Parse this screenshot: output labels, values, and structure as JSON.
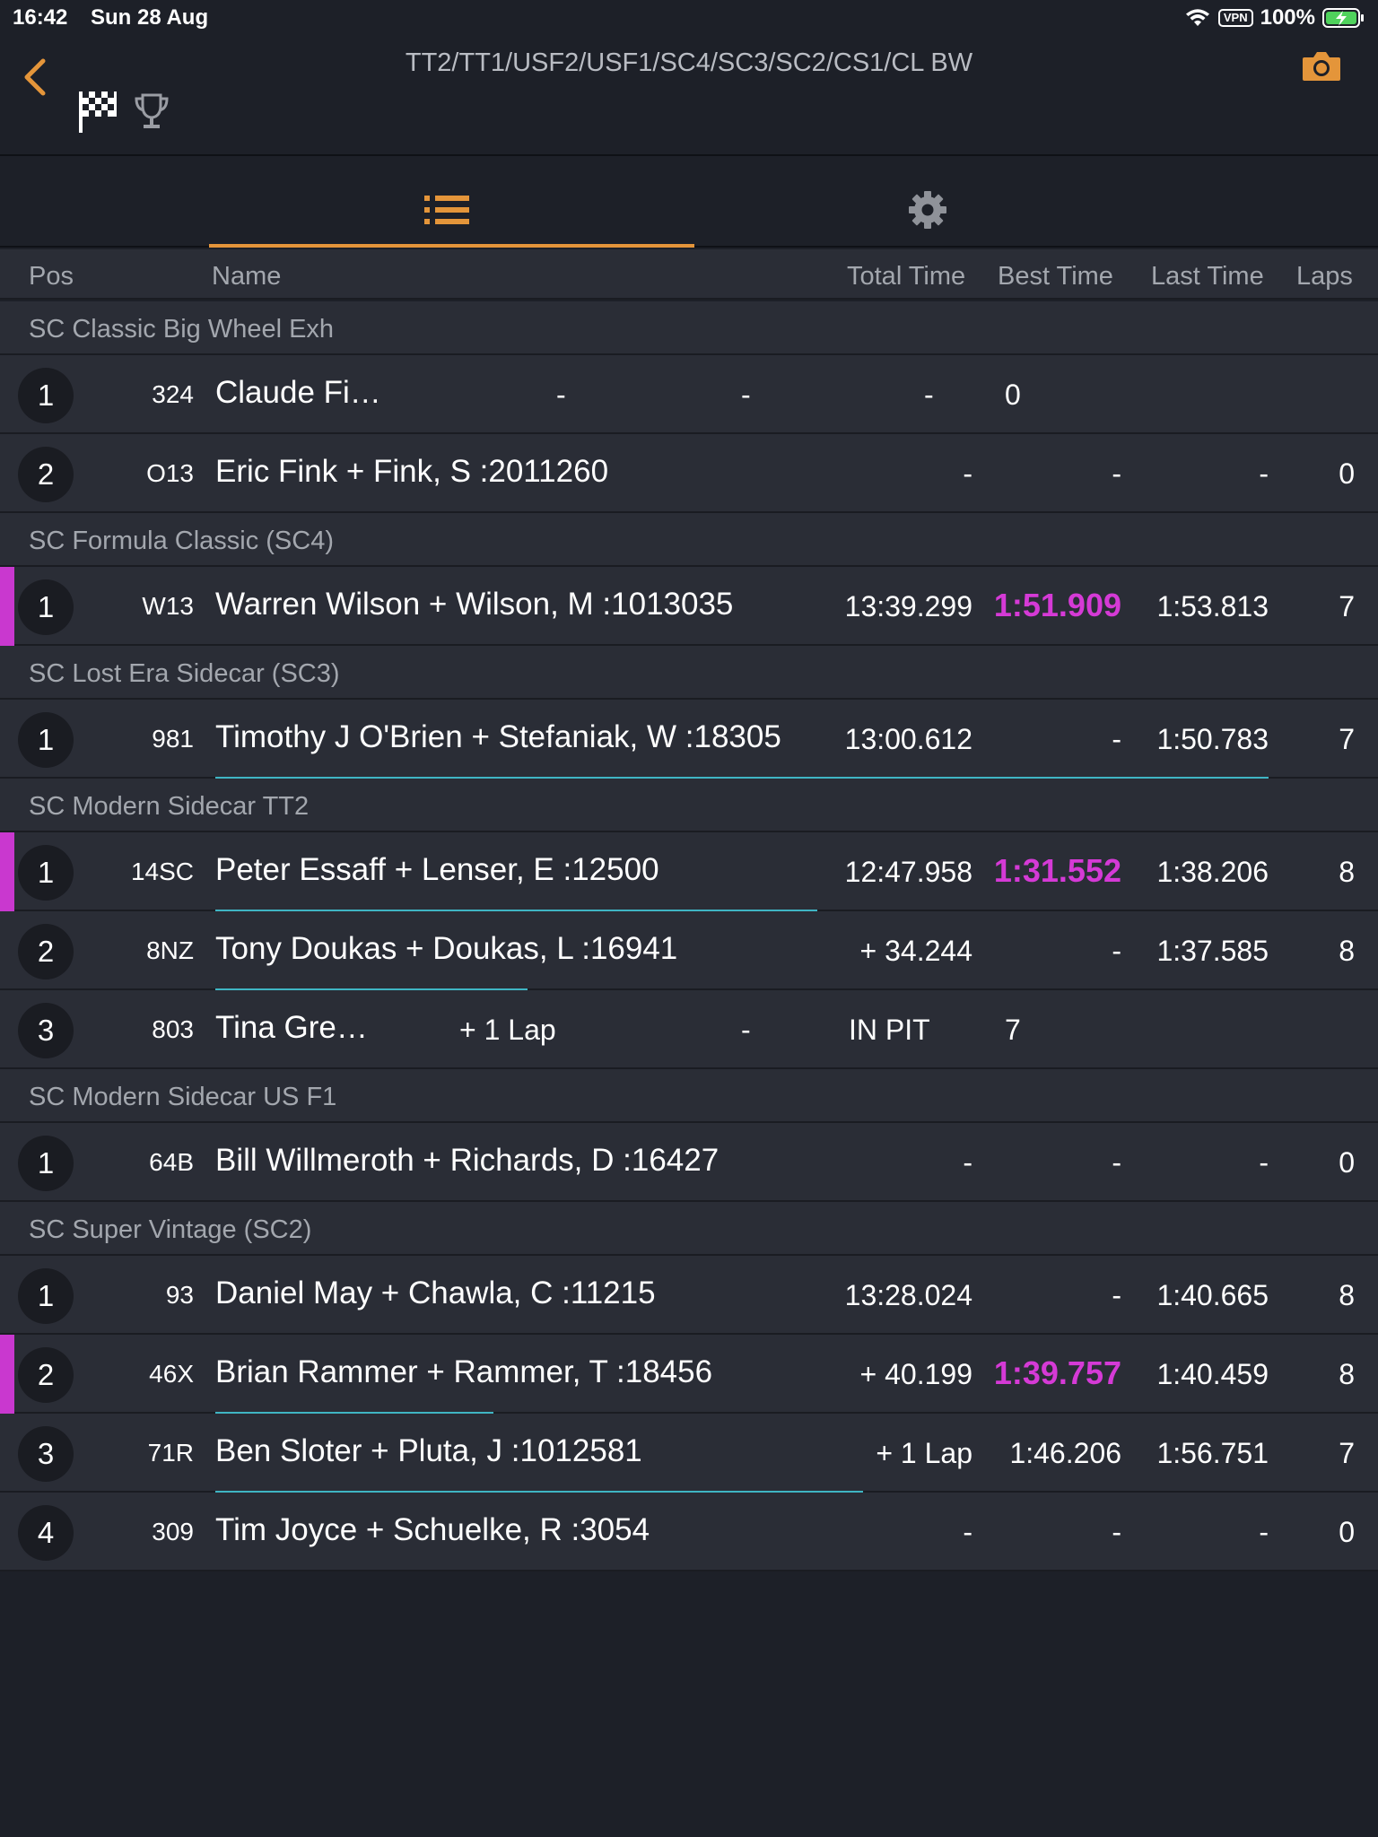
{
  "status_bar": {
    "time": "16:42",
    "date": "Sun 28 Aug",
    "vpn": "VPN",
    "battery": "100%"
  },
  "header": {
    "title": "TT2/TT1/USF2/USF1/SC4/SC3/SC2/CS1/CL BW",
    "icons": [
      "back-chevron-icon",
      "camera-icon",
      "checkered-flag-icon",
      "trophy-icon"
    ]
  },
  "tabs": [
    {
      "icon": "list-icon",
      "active": true
    },
    {
      "icon": "gear-icon",
      "active": false
    }
  ],
  "columns": {
    "pos": "Pos",
    "name": "Name",
    "total": "Total Time",
    "best": "Best Time",
    "last": "Last Time",
    "laps": "Laps"
  },
  "colors": {
    "accent": "#e4953a",
    "fastest": "#d53ad6",
    "progress": "#3fb5c4",
    "row_bg": "#2a2d36",
    "page_bg": "#1d2028"
  },
  "groups": [
    {
      "title": "SC Classic Big Wheel Exh",
      "rows": [
        {
          "pos": "1",
          "num": "324",
          "name": "Claude Fi…",
          "cells": [
            "-",
            "-",
            "-",
            "0"
          ],
          "layout": "truncated"
        },
        {
          "pos": "2",
          "num": "O13",
          "name": "Eric Fink + Fink, S :2011260",
          "total": "-",
          "best": "-",
          "last": "-",
          "laps": "0"
        }
      ]
    },
    {
      "title": "SC Formula Classic (SC4)",
      "rows": [
        {
          "pos": "1",
          "num": "W13",
          "name": "Warren Wilson + Wilson, M :1013035",
          "total": "13:39.299",
          "best": "1:51.909",
          "best_fastest": true,
          "last": "1:53.813",
          "laps": "7",
          "leader": true
        }
      ]
    },
    {
      "title": "SC Lost Era Sidecar (SC3)",
      "rows": [
        {
          "pos": "1",
          "num": "981",
          "name": "Timothy J O'Brien + Stefaniak, W :18305",
          "total": "13:00.612",
          "best": "-",
          "last": "1:50.783",
          "laps": "7",
          "progress": 0.91
        }
      ]
    },
    {
      "title": "SC Modern Sidecar TT2",
      "rows": [
        {
          "pos": "1",
          "num": "14SC",
          "name": "Peter Essaff + Lenser, E :12500",
          "total": "12:47.958",
          "best": "1:31.552",
          "best_fastest": true,
          "last": "1:38.206",
          "laps": "8",
          "leader": true,
          "progress": 0.52
        },
        {
          "pos": "2",
          "num": "8NZ",
          "name": "Tony Doukas + Doukas, L :16941",
          "total": "+ 34.244",
          "best": "-",
          "last": "1:37.585",
          "laps": "8",
          "progress": 0.27
        },
        {
          "pos": "3",
          "num": "803",
          "name": "Tina Gre…",
          "cells": [
            "+ 1 Lap",
            "-",
            "IN PIT",
            "7"
          ],
          "layout": "pit"
        }
      ]
    },
    {
      "title": "SC Modern Sidecar US F1",
      "rows": [
        {
          "pos": "1",
          "num": "64B",
          "name": "Bill Willmeroth + Richards, D :16427",
          "total": "-",
          "best": "-",
          "last": "-",
          "laps": "0"
        }
      ]
    },
    {
      "title": "SC Super Vintage (SC2)",
      "rows": [
        {
          "pos": "1",
          "num": "93",
          "name": "Daniel May + Chawla, C :11215",
          "total": "13:28.024",
          "best": "-",
          "last": "1:40.665",
          "laps": "8"
        },
        {
          "pos": "2",
          "num": "46X",
          "name": "Brian Rammer + Rammer, T :18456",
          "total": "+ 40.199",
          "best": "1:39.757",
          "best_fastest": true,
          "last": "1:40.459",
          "laps": "8",
          "leader": true,
          "progress": 0.24
        },
        {
          "pos": "3",
          "num": "71R",
          "name": "Ben Sloter + Pluta, J :1012581",
          "total": "+ 1 Lap",
          "best": "1:46.206",
          "last": "1:56.751",
          "laps": "7",
          "progress": 0.56
        },
        {
          "pos": "4",
          "num": "309",
          "name": "Tim Joyce + Schuelke, R :3054",
          "total": "-",
          "best": "-",
          "last": "-",
          "laps": "0"
        }
      ]
    }
  ]
}
